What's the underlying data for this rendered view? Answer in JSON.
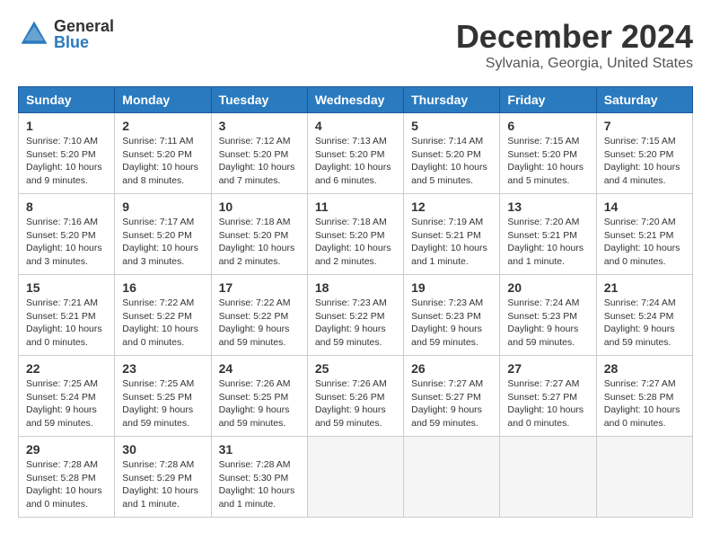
{
  "logo": {
    "general": "General",
    "blue": "Blue"
  },
  "title": "December 2024",
  "location": "Sylvania, Georgia, United States",
  "days_of_week": [
    "Sunday",
    "Monday",
    "Tuesday",
    "Wednesday",
    "Thursday",
    "Friday",
    "Saturday"
  ],
  "weeks": [
    [
      {
        "day": "1",
        "sunrise": "7:10 AM",
        "sunset": "5:20 PM",
        "daylight": "10 hours and 9 minutes."
      },
      {
        "day": "2",
        "sunrise": "7:11 AM",
        "sunset": "5:20 PM",
        "daylight": "10 hours and 8 minutes."
      },
      {
        "day": "3",
        "sunrise": "7:12 AM",
        "sunset": "5:20 PM",
        "daylight": "10 hours and 7 minutes."
      },
      {
        "day": "4",
        "sunrise": "7:13 AM",
        "sunset": "5:20 PM",
        "daylight": "10 hours and 6 minutes."
      },
      {
        "day": "5",
        "sunrise": "7:14 AM",
        "sunset": "5:20 PM",
        "daylight": "10 hours and 5 minutes."
      },
      {
        "day": "6",
        "sunrise": "7:15 AM",
        "sunset": "5:20 PM",
        "daylight": "10 hours and 5 minutes."
      },
      {
        "day": "7",
        "sunrise": "7:15 AM",
        "sunset": "5:20 PM",
        "daylight": "10 hours and 4 minutes."
      }
    ],
    [
      {
        "day": "8",
        "sunrise": "7:16 AM",
        "sunset": "5:20 PM",
        "daylight": "10 hours and 3 minutes."
      },
      {
        "day": "9",
        "sunrise": "7:17 AM",
        "sunset": "5:20 PM",
        "daylight": "10 hours and 3 minutes."
      },
      {
        "day": "10",
        "sunrise": "7:18 AM",
        "sunset": "5:20 PM",
        "daylight": "10 hours and 2 minutes."
      },
      {
        "day": "11",
        "sunrise": "7:18 AM",
        "sunset": "5:20 PM",
        "daylight": "10 hours and 2 minutes."
      },
      {
        "day": "12",
        "sunrise": "7:19 AM",
        "sunset": "5:21 PM",
        "daylight": "10 hours and 1 minute."
      },
      {
        "day": "13",
        "sunrise": "7:20 AM",
        "sunset": "5:21 PM",
        "daylight": "10 hours and 1 minute."
      },
      {
        "day": "14",
        "sunrise": "7:20 AM",
        "sunset": "5:21 PM",
        "daylight": "10 hours and 0 minutes."
      }
    ],
    [
      {
        "day": "15",
        "sunrise": "7:21 AM",
        "sunset": "5:21 PM",
        "daylight": "10 hours and 0 minutes."
      },
      {
        "day": "16",
        "sunrise": "7:22 AM",
        "sunset": "5:22 PM",
        "daylight": "10 hours and 0 minutes."
      },
      {
        "day": "17",
        "sunrise": "7:22 AM",
        "sunset": "5:22 PM",
        "daylight": "9 hours and 59 minutes."
      },
      {
        "day": "18",
        "sunrise": "7:23 AM",
        "sunset": "5:22 PM",
        "daylight": "9 hours and 59 minutes."
      },
      {
        "day": "19",
        "sunrise": "7:23 AM",
        "sunset": "5:23 PM",
        "daylight": "9 hours and 59 minutes."
      },
      {
        "day": "20",
        "sunrise": "7:24 AM",
        "sunset": "5:23 PM",
        "daylight": "9 hours and 59 minutes."
      },
      {
        "day": "21",
        "sunrise": "7:24 AM",
        "sunset": "5:24 PM",
        "daylight": "9 hours and 59 minutes."
      }
    ],
    [
      {
        "day": "22",
        "sunrise": "7:25 AM",
        "sunset": "5:24 PM",
        "daylight": "9 hours and 59 minutes."
      },
      {
        "day": "23",
        "sunrise": "7:25 AM",
        "sunset": "5:25 PM",
        "daylight": "9 hours and 59 minutes."
      },
      {
        "day": "24",
        "sunrise": "7:26 AM",
        "sunset": "5:25 PM",
        "daylight": "9 hours and 59 minutes."
      },
      {
        "day": "25",
        "sunrise": "7:26 AM",
        "sunset": "5:26 PM",
        "daylight": "9 hours and 59 minutes."
      },
      {
        "day": "26",
        "sunrise": "7:27 AM",
        "sunset": "5:27 PM",
        "daylight": "9 hours and 59 minutes."
      },
      {
        "day": "27",
        "sunrise": "7:27 AM",
        "sunset": "5:27 PM",
        "daylight": "10 hours and 0 minutes."
      },
      {
        "day": "28",
        "sunrise": "7:27 AM",
        "sunset": "5:28 PM",
        "daylight": "10 hours and 0 minutes."
      }
    ],
    [
      {
        "day": "29",
        "sunrise": "7:28 AM",
        "sunset": "5:28 PM",
        "daylight": "10 hours and 0 minutes."
      },
      {
        "day": "30",
        "sunrise": "7:28 AM",
        "sunset": "5:29 PM",
        "daylight": "10 hours and 1 minute."
      },
      {
        "day": "31",
        "sunrise": "7:28 AM",
        "sunset": "5:30 PM",
        "daylight": "10 hours and 1 minute."
      },
      null,
      null,
      null,
      null
    ]
  ]
}
